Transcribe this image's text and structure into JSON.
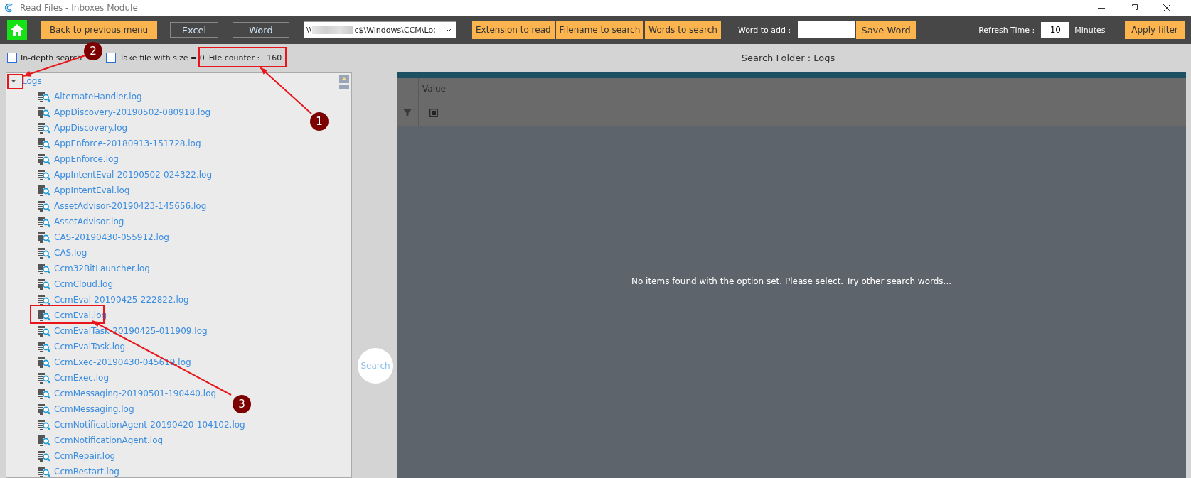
{
  "window": {
    "title": "Read Files - Inboxes Module"
  },
  "toolbar": {
    "back_button": "Back to previous menu",
    "export_buttons": [
      "Excel",
      "Word"
    ],
    "path_prefix": "\\\\",
    "path_suffix": "c$\\Windows\\CCM\\Lo;",
    "filter_buttons": [
      "Extension to read",
      "Filename to search",
      "Words to search"
    ],
    "word_to_add": {
      "label": "Word to add :",
      "button": "Save Word"
    },
    "refresh": {
      "label": "Refresh Time :",
      "value": "10",
      "unit": "Minutes"
    },
    "apply_button": "Apply filter"
  },
  "options": {
    "checkboxes": [
      {
        "label": "In-depth search",
        "checked": false
      },
      {
        "label": "Take file with size = 0",
        "checked": false
      }
    ],
    "file_counter": {
      "label": "File counter :",
      "value": "160"
    }
  },
  "tree": {
    "label": "Logs",
    "expanded": true,
    "children": [
      {
        "label": "AlternateHandler.log"
      },
      {
        "label": "AppDiscovery-20190502-080918.log"
      },
      {
        "label": "AppDiscovery.log"
      },
      {
        "label": "AppEnforce-20180913-151728.log"
      },
      {
        "label": "AppEnforce.log"
      },
      {
        "label": "AppIntentEval-20190502-024322.log"
      },
      {
        "label": "AppIntentEval.log"
      },
      {
        "label": "AssetAdvisor-20190423-145656.log"
      },
      {
        "label": "AssetAdvisor.log"
      },
      {
        "label": "CAS-20190430-055912.log"
      },
      {
        "label": "CAS.log"
      },
      {
        "label": "Ccm32BitLauncher.log"
      },
      {
        "label": "CcmCloud.log"
      },
      {
        "label": "CcmEval-20190425-222822.log"
      },
      {
        "label": "CcmEval.log"
      },
      {
        "label": "CcmEvalTask-20190425-011909.log"
      },
      {
        "label": "CcmEvalTask.log"
      },
      {
        "label": "CcmExec-20190430-045619.log"
      },
      {
        "label": "CcmExec.log"
      },
      {
        "label": "CcmMessaging-20190501-190440.log"
      },
      {
        "label": "CcmMessaging.log"
      },
      {
        "label": "CcmNotificationAgent-20190420-104102.log"
      },
      {
        "label": "CcmNotificationAgent.log"
      },
      {
        "label": "CcmRepair.log"
      },
      {
        "label": "CcmRestart.log"
      }
    ]
  },
  "search_button": "Search",
  "results": {
    "title": "Search Folder : Logs",
    "columns": [
      "Value"
    ],
    "empty_message": "No items found with the option set. Please select. Try other search words..."
  },
  "annotations": [
    {
      "number": "1"
    },
    {
      "number": "2"
    },
    {
      "number": "3"
    }
  ]
}
